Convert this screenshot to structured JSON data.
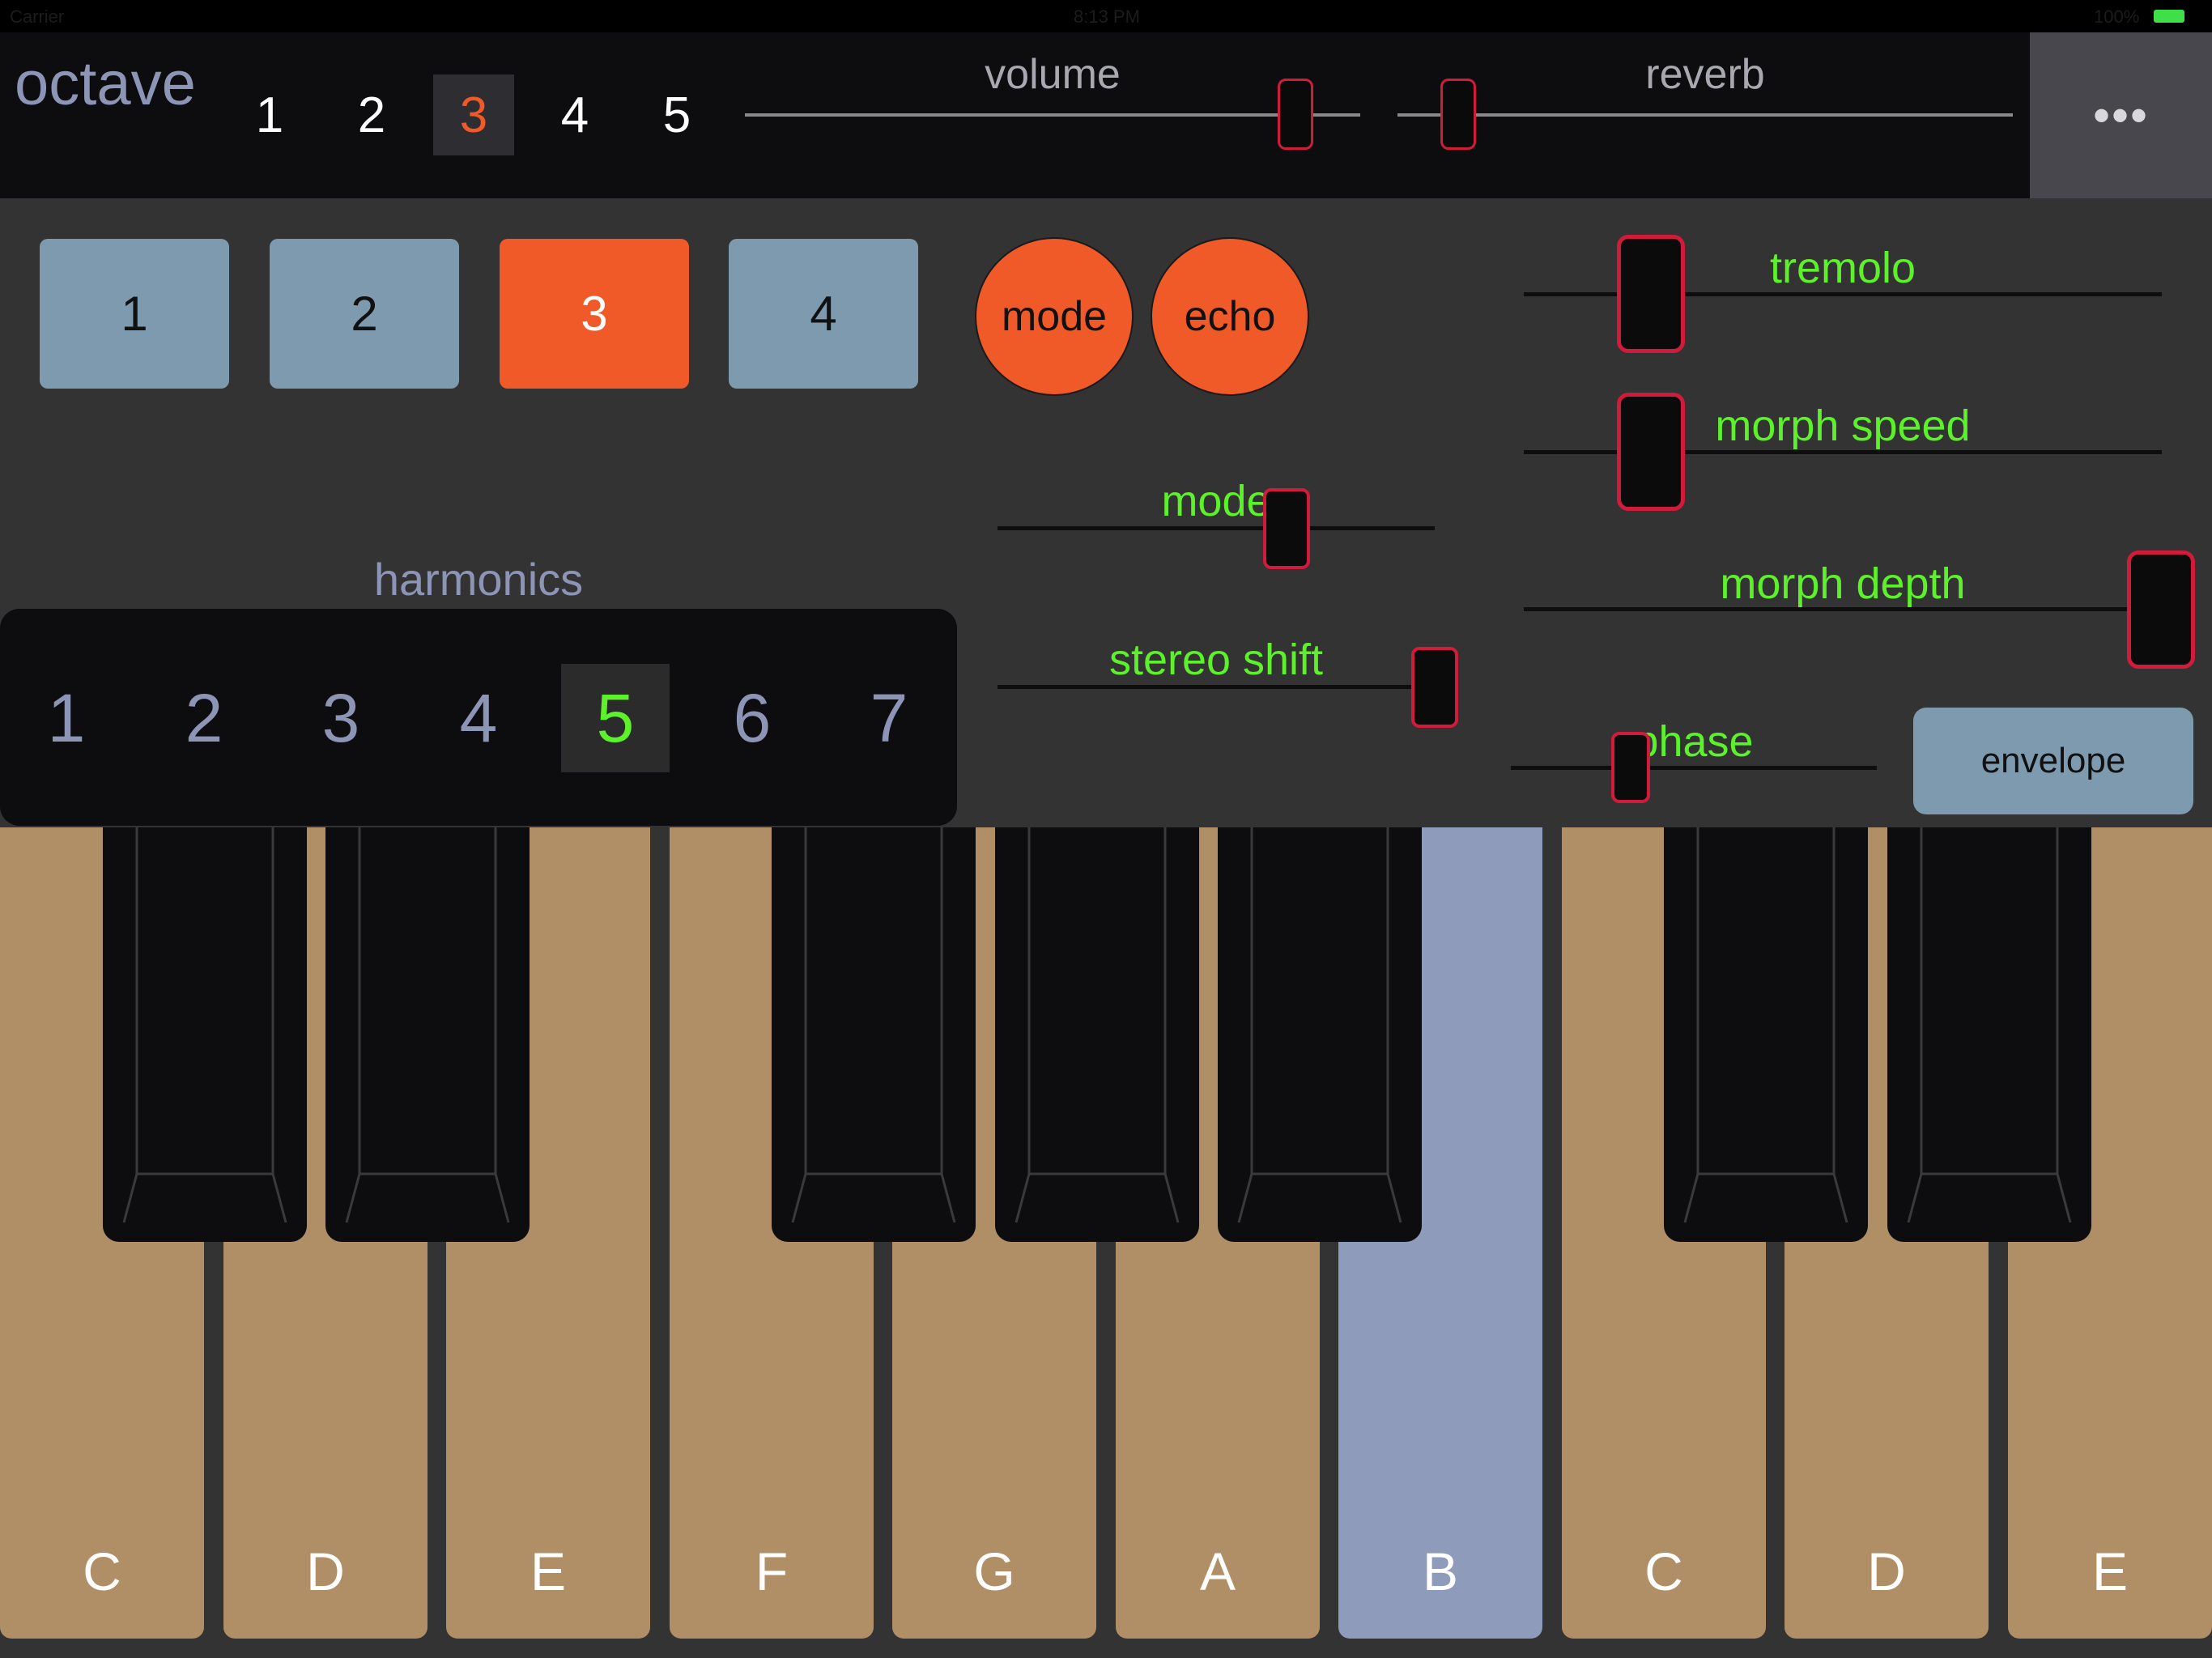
{
  "status_bar": {
    "carrier": "Carrier",
    "time": "8:13 PM",
    "battery": "100%"
  },
  "octave": {
    "label": "octave",
    "options": [
      "1",
      "2",
      "3",
      "4",
      "5"
    ],
    "selected": "3"
  },
  "volume": {
    "label": "volume",
    "value": 0.89
  },
  "reverb": {
    "label": "reverb",
    "value": 0.1
  },
  "more": {
    "label": "•••"
  },
  "presets": {
    "buttons": [
      "1",
      "2",
      "3",
      "4"
    ],
    "selected": "3"
  },
  "mode_button": {
    "label": "mode"
  },
  "echo_button": {
    "label": "echo"
  },
  "controls": {
    "mode_slider": {
      "label": "mode",
      "value": 0.66
    },
    "stereo_shift": {
      "label": "stereo shift",
      "value": 1.0
    },
    "tremolo": {
      "label": "tremolo",
      "value": 0.2
    },
    "morph_speed": {
      "label": "morph speed",
      "value": 0.2
    },
    "morph_depth": {
      "label": "morph depth",
      "value": 1.0
    },
    "phase": {
      "label": "phase",
      "value": 0.3
    }
  },
  "harmonics": {
    "label": "harmonics",
    "options": [
      "1",
      "2",
      "3",
      "4",
      "5",
      "6",
      "7"
    ],
    "selected": "5"
  },
  "envelope_button": {
    "label": "envelope"
  },
  "keyboard": {
    "white_keys": [
      "C",
      "D",
      "E",
      "F",
      "G",
      "A",
      "B",
      "C",
      "D",
      "E"
    ],
    "pressed": "B"
  },
  "colors": {
    "accent_orange": "#f05a28",
    "accent_green": "#5cf12a",
    "thumb_red": "#d01b3a",
    "white_key": "#b08f66",
    "pressed_key": "#8f9bba",
    "preset_blue": "#7d9aae"
  }
}
